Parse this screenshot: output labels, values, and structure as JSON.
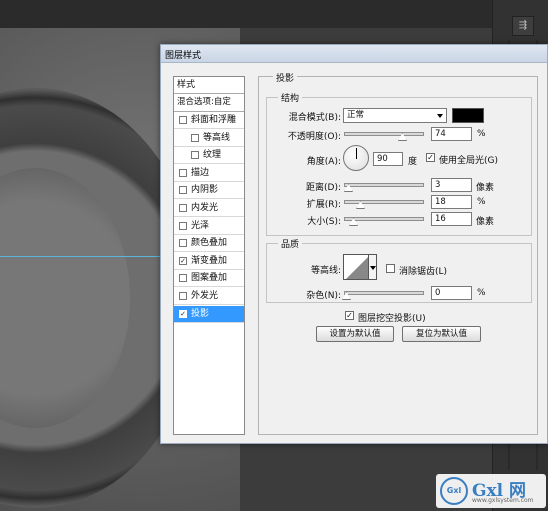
{
  "dialog": {
    "title": "图层样式"
  },
  "styles_list": {
    "header": "样式",
    "blend_options": "混合选项:自定",
    "items": [
      {
        "label": "斜面和浮雕",
        "checked": false,
        "indent": false
      },
      {
        "label": "等高线",
        "checked": false,
        "indent": true
      },
      {
        "label": "纹理",
        "checked": false,
        "indent": true
      },
      {
        "label": "描边",
        "checked": false,
        "indent": false
      },
      {
        "label": "内阴影",
        "checked": false,
        "indent": false
      },
      {
        "label": "内发光",
        "checked": false,
        "indent": false
      },
      {
        "label": "光泽",
        "checked": false,
        "indent": false
      },
      {
        "label": "颜色叠加",
        "checked": false,
        "indent": false
      },
      {
        "label": "渐变叠加",
        "checked": true,
        "indent": false
      },
      {
        "label": "图案叠加",
        "checked": false,
        "indent": false
      },
      {
        "label": "外发光",
        "checked": false,
        "indent": false
      },
      {
        "label": "投影",
        "checked": true,
        "indent": false,
        "selected": true
      }
    ],
    "check_mark": "✓"
  },
  "drop_shadow": {
    "title": "投影",
    "structure": {
      "title": "结构",
      "blend_mode_label": "混合模式(B):",
      "blend_mode_value": "正常",
      "shadow_color": "#000000",
      "opacity_label": "不透明度(O):",
      "opacity_value": "74",
      "percent": "%",
      "angle_label": "角度(A):",
      "angle_value": "90",
      "degree": "度",
      "global_light_label": "使用全局光(G)",
      "global_light_checked": true,
      "distance_label": "距离(D):",
      "distance_value": "3",
      "spread_label": "扩展(R):",
      "spread_value": "18",
      "size_label": "大小(S):",
      "size_value": "16",
      "px_unit": "像素"
    },
    "quality": {
      "title": "品质",
      "contour_label": "等高线:",
      "anti_alias_label": "消除锯齿(L)",
      "anti_alias_checked": false,
      "noise_label": "杂色(N):",
      "noise_value": "0"
    },
    "knockout_label": "图层挖空投影(U)",
    "knockout_checked": true,
    "make_default_button": "设置为默认值",
    "reset_default_button": "复位为默认值"
  },
  "watermark": {
    "brand": "Gxl 网",
    "sub": "www.gxlsystem.com",
    "logo": "Gxl"
  }
}
